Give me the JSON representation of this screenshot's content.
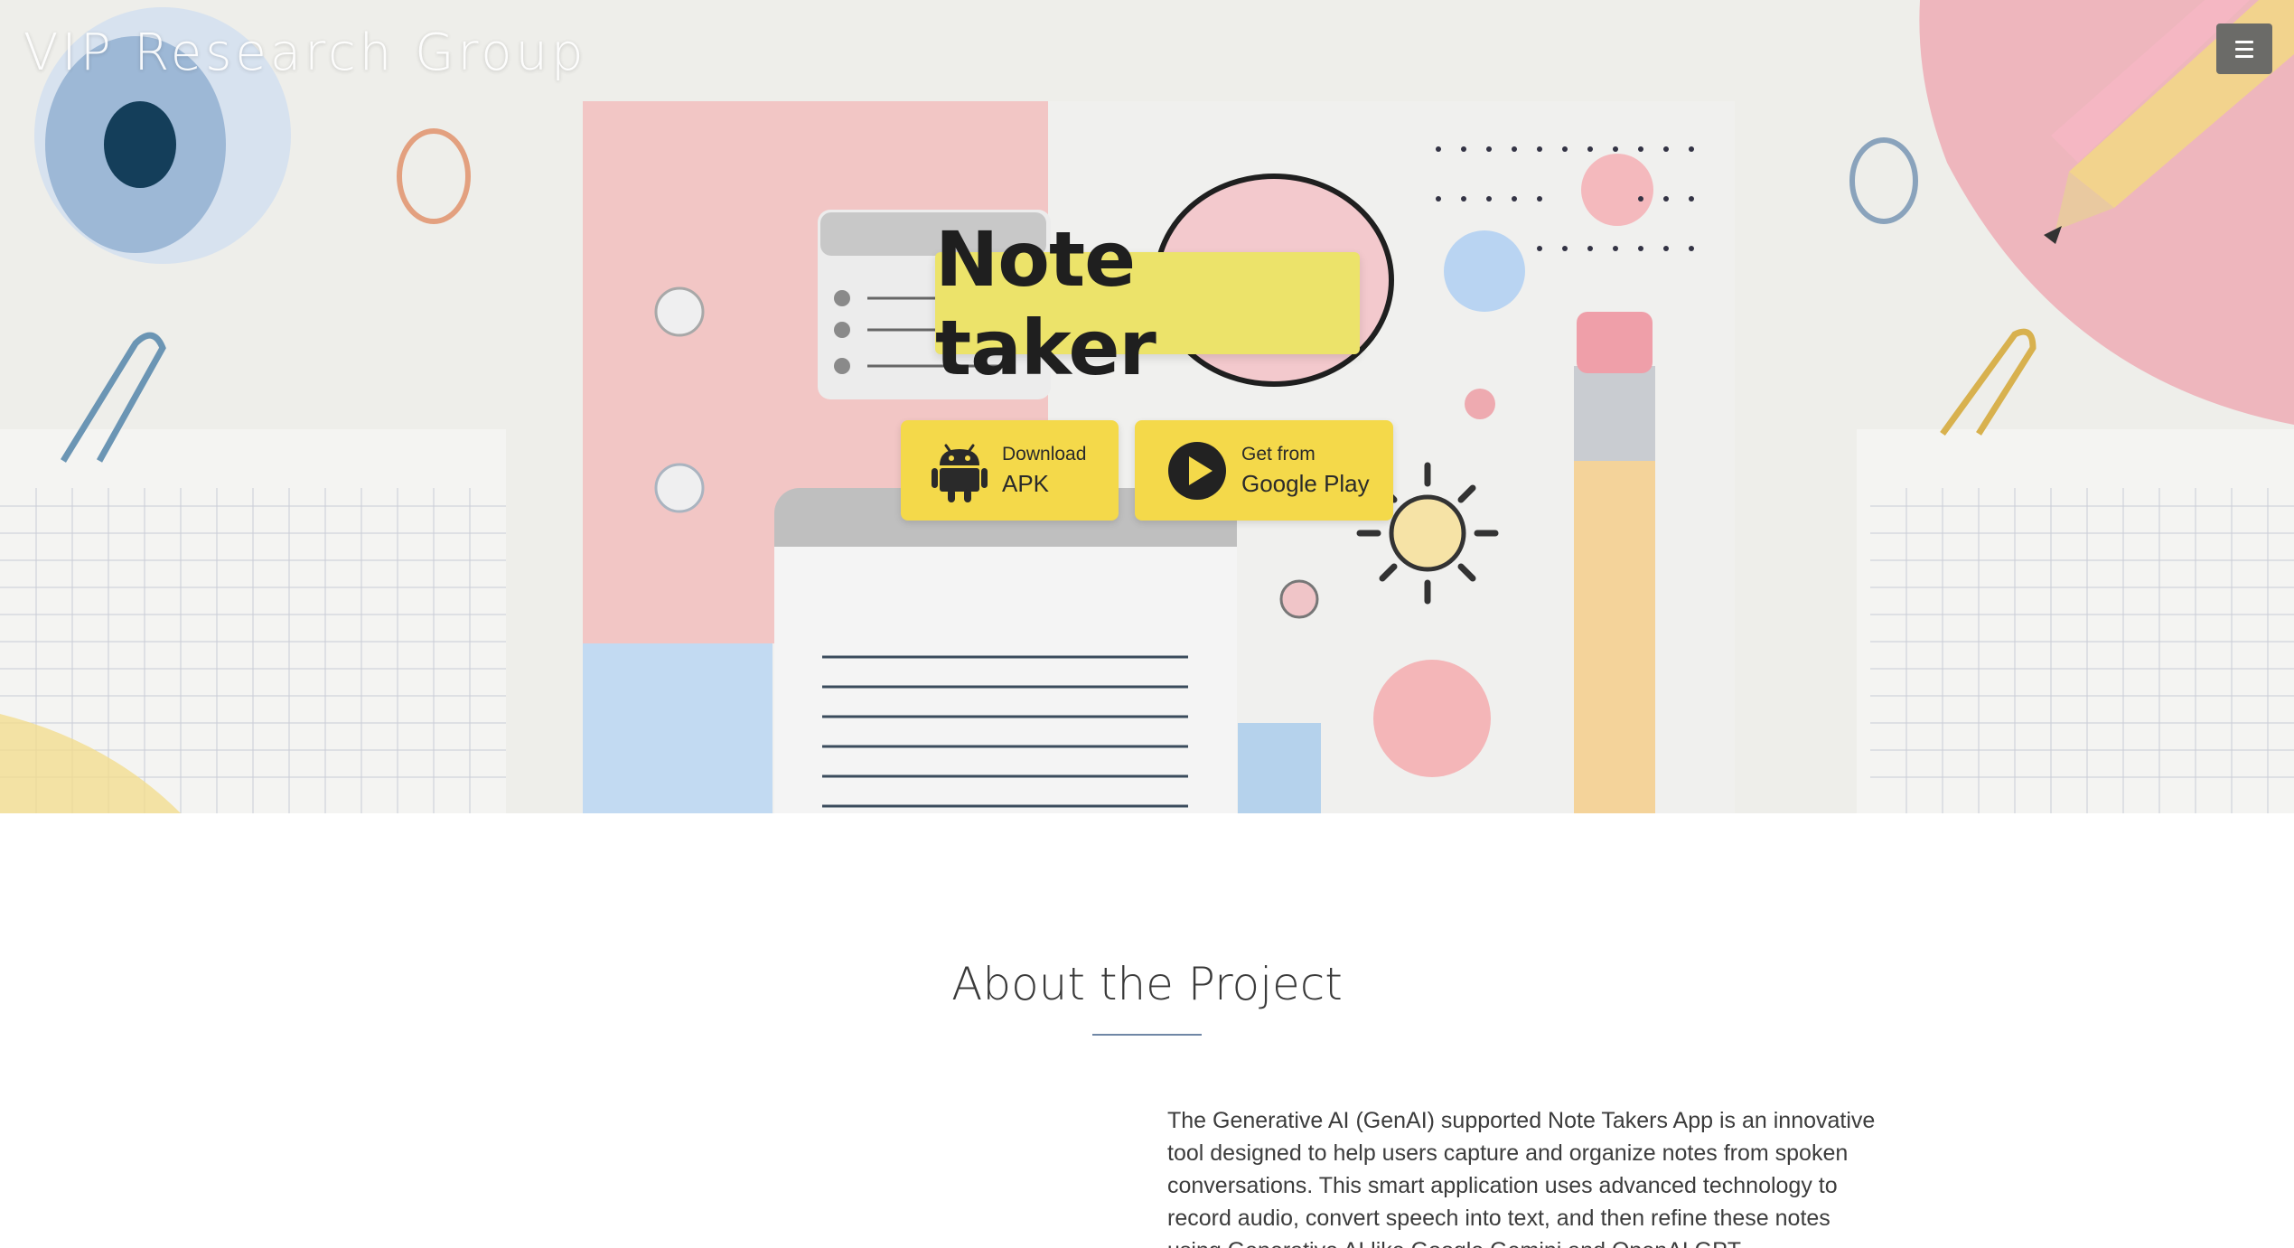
{
  "header": {
    "brand": "VIP Research Group",
    "menu_icon": "hamburger-menu-icon"
  },
  "hero": {
    "title": "Note taker",
    "buttons": [
      {
        "small": "Download",
        "big": "APK",
        "icon": "android-icon"
      },
      {
        "small": "Get from",
        "big": "Google Play",
        "icon": "play-icon"
      }
    ]
  },
  "about": {
    "title": "About the Project",
    "paragraph": "The Generative AI (GenAI) supported Note Takers App is an innovative tool designed to help users capture and organize notes from spoken conversations. This smart application uses advanced technology to record audio, convert speech into text, and then refine these notes using Generative AI like Google Gemini and OpenAI GPT."
  },
  "colors": {
    "title_bg": "#ece36a",
    "button_bg": "#f4d94a",
    "accent_rule": "#6f87a6",
    "menu_bg": "#6b6b68"
  }
}
